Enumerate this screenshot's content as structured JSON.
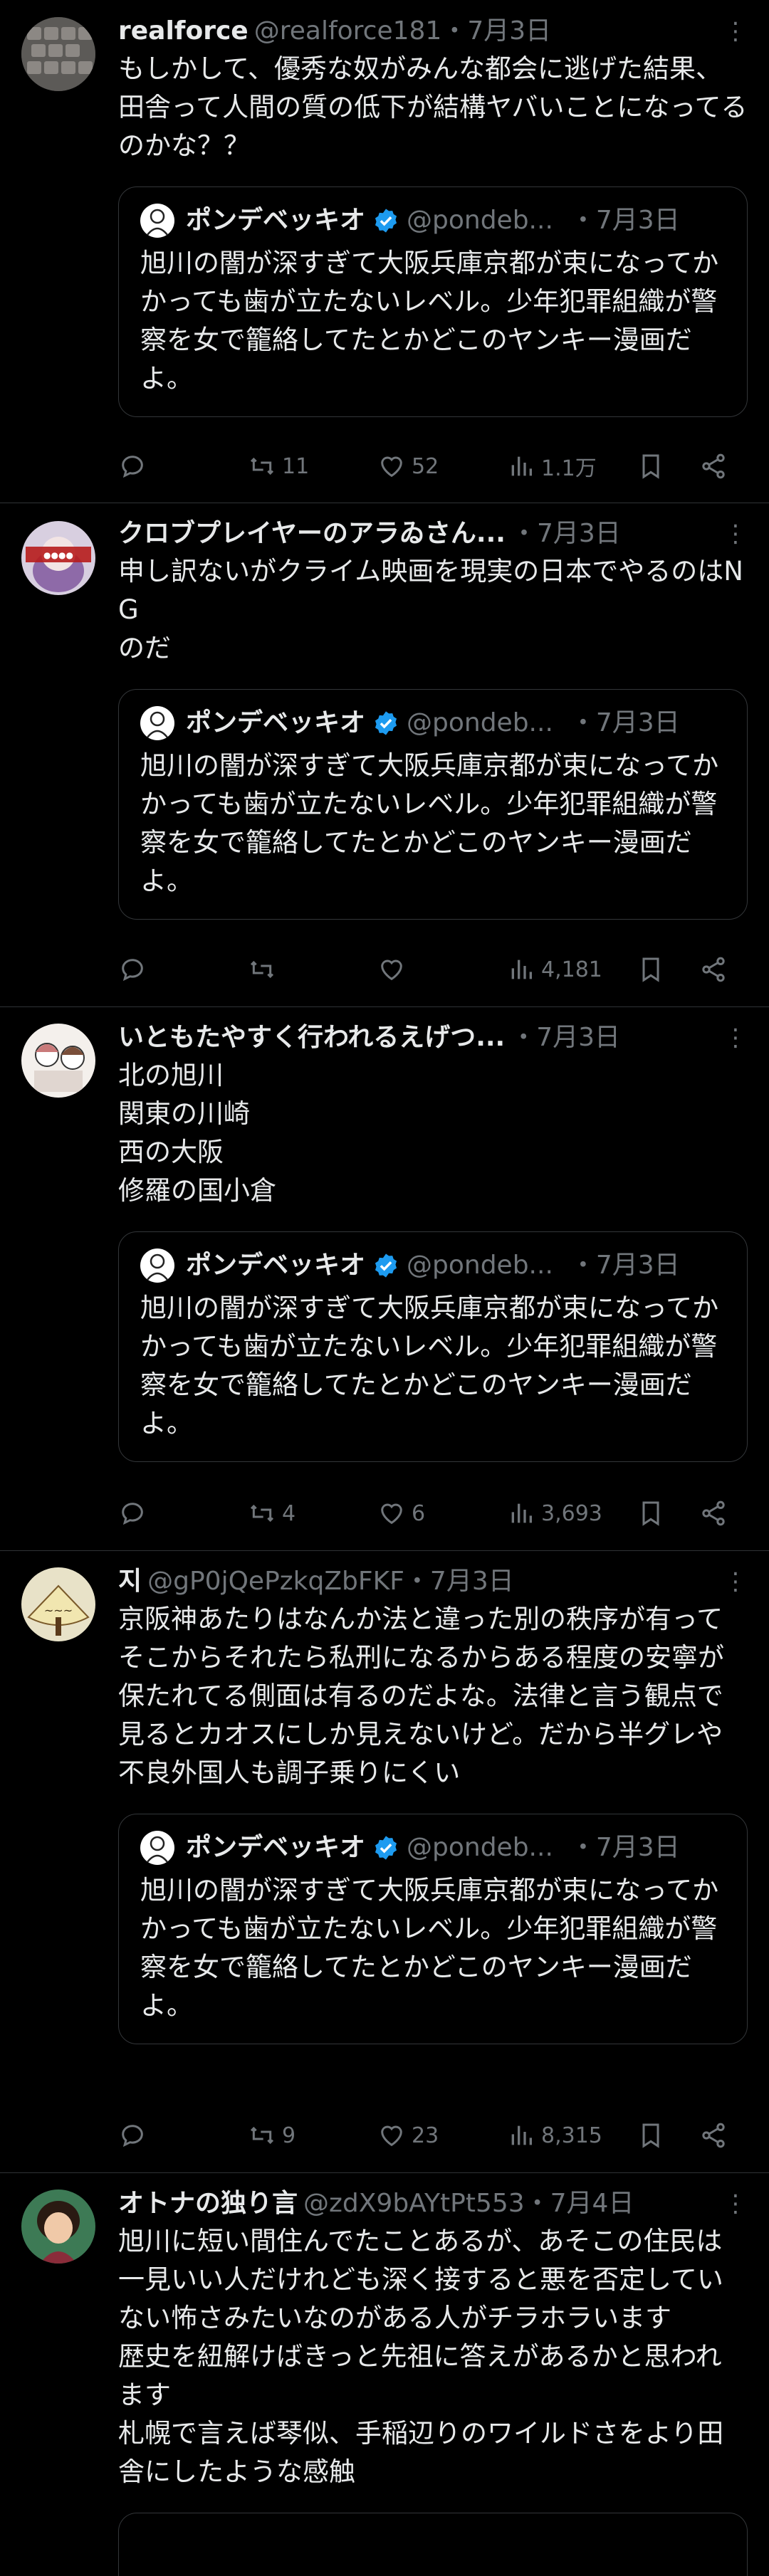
{
  "quoted": {
    "name": "ポンデベッキオ",
    "handle": "@pondeb...",
    "date": "・7月3日",
    "text": "旭川の闇が深すぎて大阪兵庫京都が束になってかかっても歯が立たないレベル。少年犯罪組織が警察を女で籠絡してたとかどこのヤンキー漫画だよ。"
  },
  "colors": {
    "verified": "#1d9bf0",
    "muted": "#71767b",
    "border": "#2f3336"
  },
  "tweets": [
    {
      "name": "realforce",
      "handle": "@realforce181",
      "date": "・7月3日",
      "text": [
        "もしかして、優秀な奴がみんな都会に逃げた結果、田舎って人間の質の低下が結構ヤバいことになってるのかな？？"
      ],
      "quote_handle": "@pondeb...",
      "replies": "",
      "retweets": "11",
      "likes": "52",
      "views": "1.1万"
    },
    {
      "name": "クロブプレイヤーのアラゐさん...",
      "handle": "",
      "date": "・7月3日",
      "text": [
        "申し訳ないがクライム映画を現実の日本でやるのはNG",
        "のだ"
      ],
      "quote_handle": "@pondeb...",
      "replies": "",
      "retweets": "",
      "likes": "",
      "views": "4,181"
    },
    {
      "name": "いともたやすく行われるえげつ...",
      "handle": "",
      "date": "・7月3日",
      "text": [
        "北の旭川",
        "関東の川崎",
        "西の大阪",
        "修羅の国小倉"
      ],
      "quote_handle": "@pondeb...",
      "replies": "",
      "retweets": "4",
      "likes": "6",
      "views": "3,693"
    },
    {
      "name": "지",
      "handle": "@gP0jQePzkqZbFKF",
      "date": "・7月3日",
      "text": [
        "京阪神あたりはなんか法と違った別の秩序が有ってそこからそれたら私刑になるからある程度の安寧が保たれてる側面は有るのだよな。法律と言う観点で見るとカオスにしか見えないけど。だから半グレや不良外国人も調子乗りにくい"
      ],
      "quote_handle": "@pondeb...",
      "replies": "",
      "retweets": "9",
      "likes": "23",
      "views": "8,315"
    },
    {
      "name": "オトナの独り言",
      "handle": "@zdX9bAYtPt553",
      "date": "・7月4日",
      "text": [
        "旭川に短い間住んでたことあるが、あそこの住民は一見いい人だけれども深く接すると悪を否定していない怖さみたいなのがある人がチラホラいます",
        "歴史を紐解けばきっと先祖に答えがあるかと思われます",
        "札幌で言えば琴似、手稲辺りのワイルドさをより田舎にしたような感触"
      ]
    }
  ]
}
